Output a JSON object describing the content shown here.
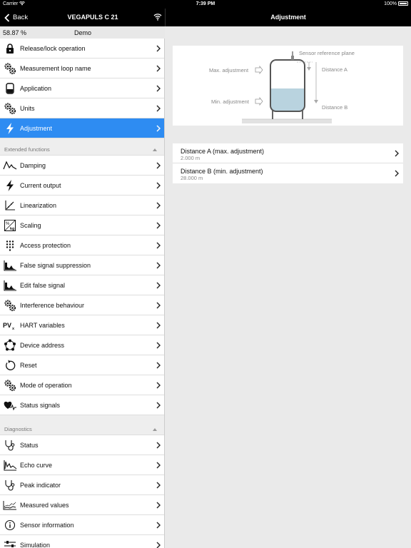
{
  "status_bar": {
    "carrier": "Carrier",
    "time": "7:39 PM",
    "battery": "100%"
  },
  "left_nav": {
    "back_label": "Back",
    "title": "VEGAPULS C 21"
  },
  "right_nav": {
    "title": "Adjustment"
  },
  "info_bar": {
    "percent": "58.87 %",
    "mode": "Demo"
  },
  "sidebar": {
    "items": [
      {
        "label": "Release/lock operation",
        "icon": "lock-icon"
      },
      {
        "label": "Measurement loop name",
        "icon": "gears-icon"
      },
      {
        "label": "Application",
        "icon": "tank-icon"
      },
      {
        "label": "Units",
        "icon": "gears-icon"
      },
      {
        "label": "Adjustment",
        "icon": "lightning-icon",
        "selected": true
      }
    ],
    "extended": {
      "title": "Extended functions",
      "items": [
        {
          "label": "Damping",
          "icon": "damping-icon"
        },
        {
          "label": "Current output",
          "icon": "lightning-icon"
        },
        {
          "label": "Linearization",
          "icon": "linearization-icon"
        },
        {
          "label": "Scaling",
          "icon": "scaling-icon"
        },
        {
          "label": "Access protection",
          "icon": "keypad-icon"
        },
        {
          "label": "False signal suppression",
          "icon": "false-signal-icon"
        },
        {
          "label": "Edit false signal",
          "icon": "false-signal-icon"
        },
        {
          "label": "Interference behaviour",
          "icon": "gears-icon"
        },
        {
          "label": "HART variables",
          "icon": "pv-icon"
        },
        {
          "label": "Device address",
          "icon": "network-icon"
        },
        {
          "label": "Reset",
          "icon": "reset-icon"
        },
        {
          "label": "Mode of operation",
          "icon": "gears-icon"
        },
        {
          "label": "Status signals",
          "icon": "heart-icon"
        }
      ]
    },
    "diagnostics": {
      "title": "Diagnostics",
      "items": [
        {
          "label": "Status",
          "icon": "stethoscope-icon"
        },
        {
          "label": "Echo curve",
          "icon": "echo-curve-icon"
        },
        {
          "label": "Peak indicator",
          "icon": "stethoscope-icon"
        },
        {
          "label": "Measured values",
          "icon": "measured-values-icon"
        },
        {
          "label": "Sensor information",
          "icon": "info-icon"
        },
        {
          "label": "Simulation",
          "icon": "sliders-icon"
        }
      ]
    }
  },
  "diagram": {
    "sensor_label": "Sensor reference plane",
    "max_label": "Max. adjustment",
    "min_label": "Min. adjustment",
    "distance_a_label": "Distance A",
    "distance_b_label": "Distance B"
  },
  "adjustments": [
    {
      "title": "Distance A (max. adjustment)",
      "value": "2.000 m"
    },
    {
      "title": "Distance B (min. adjustment)",
      "value": "28.000 m"
    }
  ],
  "colors": {
    "accent": "#2e8cf2",
    "nav_bg": "#000000",
    "liquid": "#b9d3df"
  }
}
